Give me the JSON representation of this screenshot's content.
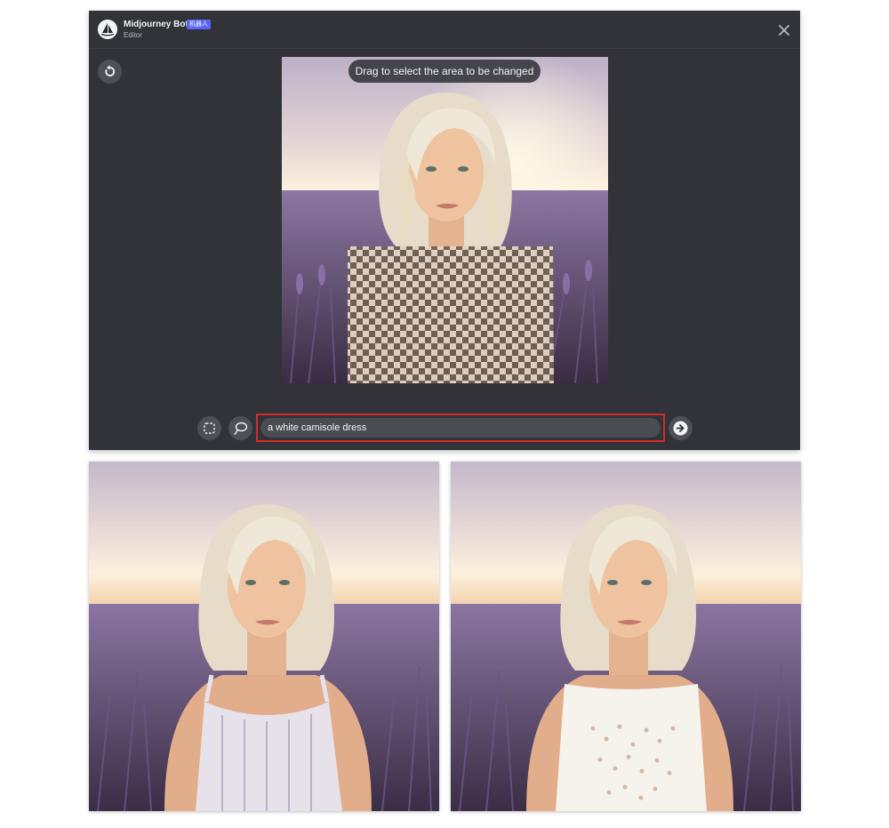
{
  "header": {
    "bot_name": "Midjourney Bot",
    "bot_badge": "机器人",
    "subtitle": "Editor"
  },
  "canvas": {
    "hint": "Drag to select the area to be changed"
  },
  "prompt": {
    "value": "a white camisole dress"
  },
  "colors": {
    "editor_bg": "#313338",
    "badge": "#5865f2",
    "highlight_border": "#d12b2b",
    "lavender": "#7a6498"
  },
  "icons": {
    "close": "close-icon",
    "undo": "undo-icon",
    "rect_select": "rectangle-select-icon",
    "lasso": "lasso-icon",
    "submit": "arrow-right-icon"
  }
}
